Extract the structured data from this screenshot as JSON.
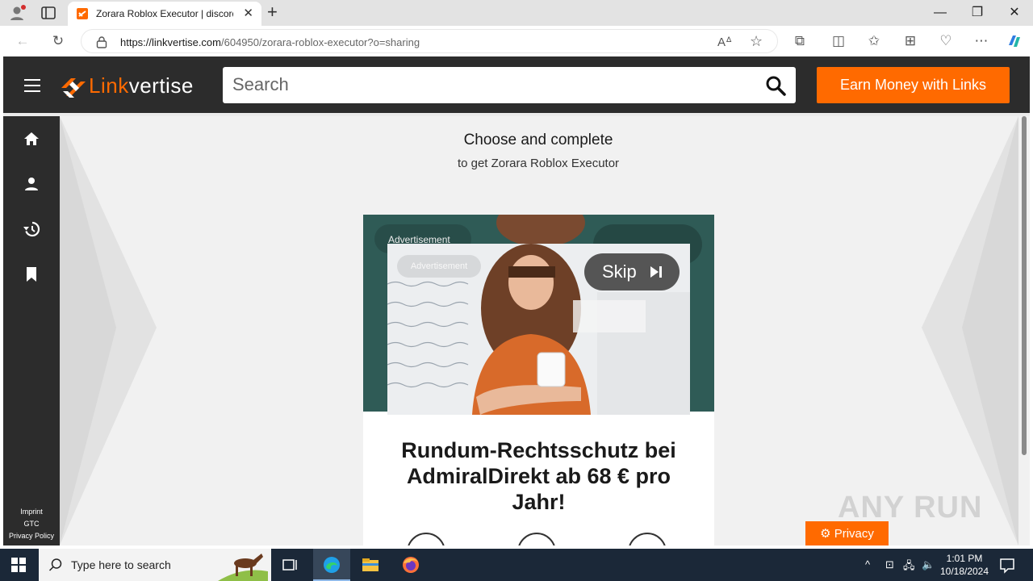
{
  "browser": {
    "tab": {
      "title": "Zorara Roblox Executor | discord"
    },
    "url": {
      "domain": "https://linkvertise.com",
      "path": "/604950/zorara-roblox-executor?o=sharing"
    }
  },
  "header": {
    "logo_text_a": "Link",
    "logo_text_b": "vertise",
    "search_placeholder": "Search",
    "earn_button": "Earn Money with Links"
  },
  "sidebar": {
    "items": [
      {
        "name": "home",
        "icon": "home-icon"
      },
      {
        "name": "profile",
        "icon": "user-icon"
      },
      {
        "name": "history",
        "icon": "history-icon"
      },
      {
        "name": "bookmarks",
        "icon": "bookmark-icon"
      }
    ],
    "links": [
      "Imprint",
      "GTC",
      "Privacy Policy"
    ]
  },
  "main": {
    "headline": "Choose and complete",
    "subline": "to get Zorara Roblox Executor"
  },
  "ad": {
    "label_back": "Advertisement",
    "label": "Advertisement",
    "skip": "Skip",
    "title": "Rundum-Rechtsschutz bei AdmiralDirekt ab 68 € pro Jahr!"
  },
  "privacy_button": "Privacy",
  "watermark": "ANY RUN",
  "taskbar": {
    "search_placeholder": "Type here to search",
    "time": "1:01 PM",
    "date": "10/18/2024"
  },
  "colors": {
    "brand": "#ff6a00",
    "header": "#2c2c2c",
    "taskbar": "#1b2838"
  }
}
